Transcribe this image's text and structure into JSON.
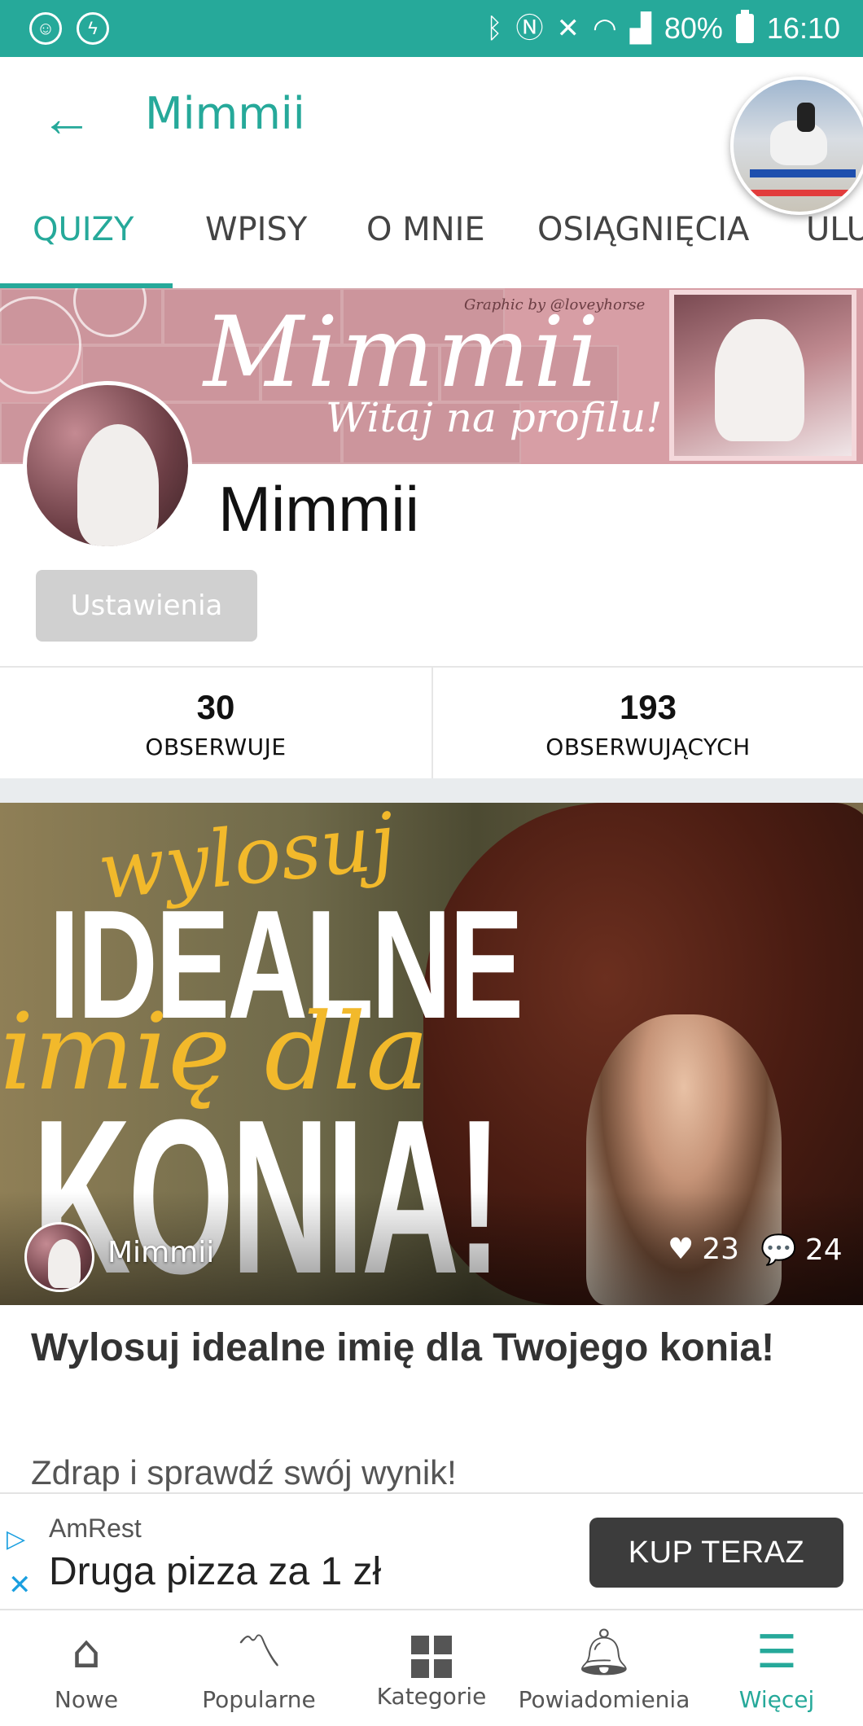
{
  "status_bar": {
    "left_icons": [
      "accessibility-icon",
      "messenger-icon"
    ],
    "right_icons": [
      "bluetooth-icon",
      "nfc-icon",
      "mute-icon",
      "wifi-icon",
      "signal-icon"
    ],
    "battery": "80%",
    "time": "16:10"
  },
  "app_bar": {
    "title": "Mimmii"
  },
  "tabs": [
    {
      "label": "QUIZY",
      "active": true
    },
    {
      "label": "WPISY",
      "active": false
    },
    {
      "label": "O MNIE",
      "active": false
    },
    {
      "label": "OSIĄGNIĘCIA",
      "active": false
    },
    {
      "label": "ULU",
      "active": false
    }
  ],
  "banner": {
    "script_title": "Mimmii",
    "subtitle": "Witaj na profilu!",
    "credit": "Graphic by @loveyhorse"
  },
  "profile": {
    "name": "Mimmii",
    "settings_label": "Ustawienia"
  },
  "stats": {
    "following_count": "30",
    "following_label": "OBSERWUJE",
    "followers_count": "193",
    "followers_label": "OBSERWUJĄCYCH"
  },
  "quiz": {
    "image_text": {
      "line1": "wylosuj",
      "line2": "IDEALNE",
      "line3": "imię dla",
      "line4": "KONIA!"
    },
    "author": "Mimmii",
    "likes": "23",
    "comments": "24",
    "title": "Wylosuj idealne imię dla Twojego konia!",
    "description": "Zdrap i sprawdź swój wynik!"
  },
  "ad": {
    "brand": "AmRest",
    "headline": "Druga pizza za 1 zł",
    "cta": "KUP TERAZ"
  },
  "bottom_nav": [
    {
      "label": "Nowe",
      "icon": "home-icon",
      "active": false
    },
    {
      "label": "Popularne",
      "icon": "trending-icon",
      "active": false
    },
    {
      "label": "Kategorie",
      "icon": "grid-icon",
      "active": false
    },
    {
      "label": "Powiadomienia",
      "icon": "bell-icon",
      "active": false
    },
    {
      "label": "Więcej",
      "icon": "menu-icon",
      "active": true
    }
  ],
  "colors": {
    "accent": "#26a99a",
    "banner_pink": "#d79ea5",
    "cta_dark": "#3c3c3c"
  }
}
